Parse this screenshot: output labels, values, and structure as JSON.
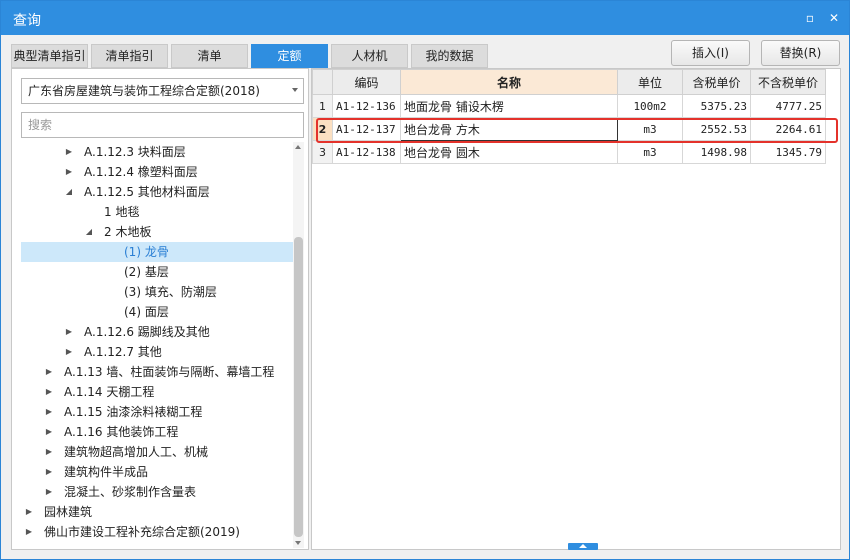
{
  "window": {
    "title": "查询",
    "restore_glyph": "▫",
    "close_glyph": "✕"
  },
  "tabs": [
    {
      "label": "典型清单指引"
    },
    {
      "label": "清单指引"
    },
    {
      "label": "清单"
    },
    {
      "label": "定额",
      "active": true
    },
    {
      "label": "人材机"
    },
    {
      "label": "我的数据"
    }
  ],
  "actions": {
    "insert_label": "插入(I)",
    "replace_label": "替换(R)"
  },
  "library": {
    "selected": "广东省房屋建筑与装饰工程综合定额(2018)"
  },
  "search": {
    "placeholder": "搜索",
    "value": ""
  },
  "tree": {
    "nodes": [
      {
        "label": "A.1.12.3 块料面层",
        "toggle": "▶"
      },
      {
        "label": "A.1.12.4 橡塑料面层",
        "toggle": "▶"
      },
      {
        "label": "A.1.12.5 其他材料面层",
        "toggle": "◢"
      },
      {
        "label": "1 地毯",
        "toggle": ""
      },
      {
        "label": "2 木地板",
        "toggle": "◢"
      },
      {
        "label": "(1) 龙骨",
        "toggle": "",
        "selected": true
      },
      {
        "label": "(2) 基层",
        "toggle": ""
      },
      {
        "label": "(3) 填充、防潮层",
        "toggle": ""
      },
      {
        "label": "(4) 面层",
        "toggle": ""
      },
      {
        "label": "A.1.12.6 踢脚线及其他",
        "toggle": "▶"
      },
      {
        "label": "A.1.12.7 其他",
        "toggle": "▶"
      },
      {
        "label": "A.1.13 墙、柱面装饰与隔断、幕墙工程",
        "toggle": "▶"
      },
      {
        "label": "A.1.14 天棚工程",
        "toggle": "▶"
      },
      {
        "label": "A.1.15 油漆涂料裱糊工程",
        "toggle": "▶"
      },
      {
        "label": "A.1.16 其他装饰工程",
        "toggle": "▶"
      },
      {
        "label": "建筑物超高增加人工、机械",
        "toggle": "▶"
      },
      {
        "label": "建筑构件半成品",
        "toggle": "▶"
      },
      {
        "label": "混凝土、砂浆制作含量表",
        "toggle": "▶"
      },
      {
        "label": "园林建筑",
        "toggle": "▶"
      },
      {
        "label": "佛山市建设工程补充综合定额(2019)",
        "toggle": "▶"
      }
    ]
  },
  "grid": {
    "columns": [
      "",
      "编码",
      "名称",
      "单位",
      "含税单价",
      "不含税单价"
    ],
    "rows": [
      {
        "no": "1",
        "code": "A1-12-136",
        "name": "地面龙骨 铺设木楞",
        "unit": "100m2",
        "price_tax": "5375.23",
        "price_notax": "4777.25"
      },
      {
        "no": "2",
        "code": "A1-12-137",
        "name": "地台龙骨 方木",
        "unit": "m3",
        "price_tax": "2552.53",
        "price_notax": "2264.61"
      },
      {
        "no": "3",
        "code": "A1-12-138",
        "name": "地台龙骨 圆木",
        "unit": "m3",
        "price_tax": "1498.98",
        "price_notax": "1345.79"
      }
    ]
  },
  "colors": {
    "accent": "#2f8ee0",
    "highlight": "#e4322b",
    "selected_bg": "#cde8fa"
  }
}
